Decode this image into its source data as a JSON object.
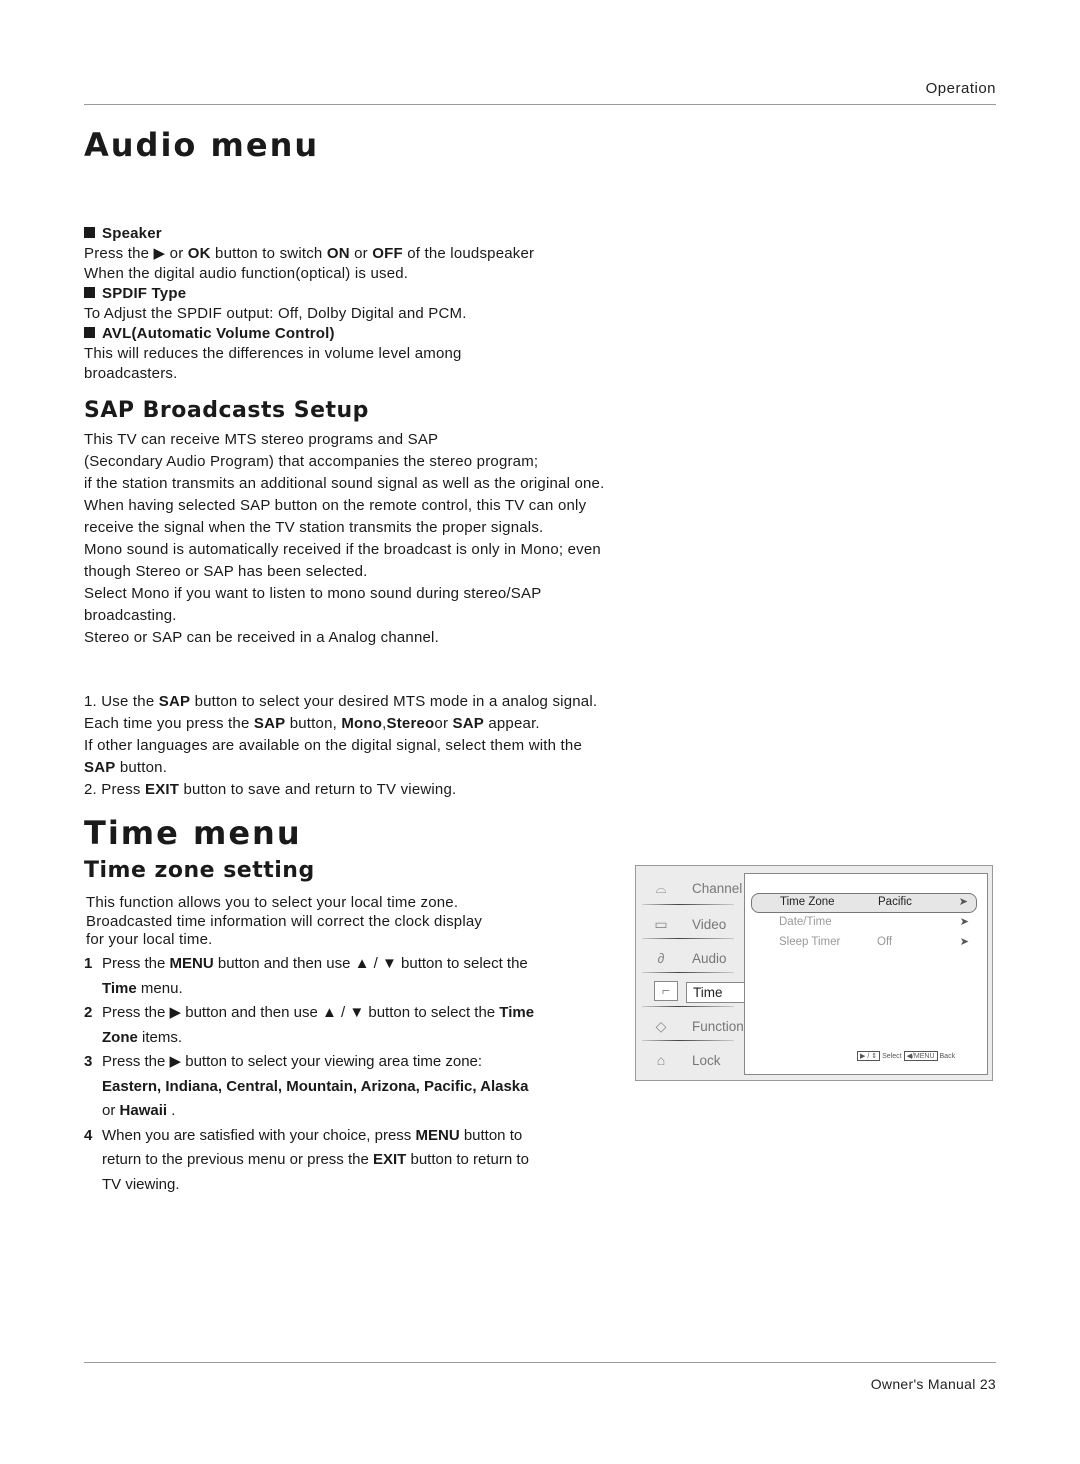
{
  "header": {
    "section_label": "Operation"
  },
  "audio_menu": {
    "title": "Audio menu",
    "items": [
      {
        "heading": "Speaker",
        "body": "Press the ▶ or OK button to switch ON or OFF of the loudspeaker When the digital audio function(optical) is used."
      },
      {
        "heading": "SPDIF Type",
        "body": "To Adjust the SPDIF output: Off, Dolby Digital and  PCM."
      },
      {
        "heading": "AVL(Automatic Volume Control)",
        "body": "This will reduces the differences in volume level among broadcasters."
      }
    ],
    "speaker_body": {
      "l1a": "Press the ",
      "l1b": " or ",
      "l1c": "OK",
      "l1d": " button to switch ",
      "l1e": "ON",
      "l1f": " or ",
      "l1g": "OFF",
      "l1h": " of the loudspeaker",
      "l2": "When the digital audio function(optical) is used."
    },
    "spdif_body": "To Adjust the SPDIF output: Off, Dolby Digital and  PCM.",
    "avl_body_1": "This will reduces the differences in volume level among",
    "avl_body_2": "broadcasters."
  },
  "sap": {
    "title": "SAP Broadcasts Setup",
    "lines": [
      "This TV can receive MTS stereo programs and SAP",
      "(Secondary Audio Program) that accompanies the stereo program;",
      "if the station transmits an additional sound signal as well as the original one.",
      "When having selected SAP button on the remote control, this TV can only",
      "receive the signal when the TV station transmits the proper signals.",
      "Mono sound is automatically received if the broadcast is only in Mono; even",
      "though Stereo or SAP has been selected.",
      "Select Mono if you want to listen to mono sound during stereo/SAP",
      "broadcasting.",
      "Stereo or SAP can be received in a Analog channel."
    ],
    "step1": {
      "a": "1. Use the ",
      "b": "SAP",
      "c": " button to select your desired MTS mode in a analog signal.",
      "d": "Each time you press the ",
      "e": "SAP",
      "f": " button, ",
      "g": "Mono",
      "h": ",",
      "i": "Stereo",
      "j": "or ",
      "k": "SAP",
      "l": " appear.",
      "m": "If other languages are available on the digital signal, select them with the",
      "n": "SAP",
      "o": " button."
    },
    "step2": {
      "a": "2. Press ",
      "b": "EXIT",
      "c": " button to save and return to TV viewing."
    }
  },
  "time_menu": {
    "title": "Time menu",
    "subtitle": "Time zone setting",
    "intro": [
      "This function allows you to select your local time zone.",
      "Broadcasted time information will correct the clock display",
      "for your local time."
    ],
    "steps": [
      {
        "num": "1",
        "parts": [
          "Press the ",
          "MENU",
          " button and then use ▲ / ▼ button to select the ",
          "Time",
          " menu."
        ]
      },
      {
        "num": "2",
        "parts": [
          "Press the ▶ button and then use ▲ / ▼ button to select the ",
          "Time Zone",
          " items."
        ]
      },
      {
        "num": "3",
        "parts": [
          "Press the ▶ button  to select your viewing area time zone:  ",
          "Eastern, Indiana, Central, Mountain,  Arizona, Pacific, Alaska",
          " or ",
          "Hawaii",
          " ."
        ]
      },
      {
        "num": "4",
        "parts": [
          "When you are satisfied with your choice,  press ",
          "MENU",
          " button to return to the previous menu or press the ",
          "EXIT",
          " button to return to TV viewing."
        ]
      }
    ]
  },
  "tv_osd": {
    "sidebar": [
      {
        "label": "Channel",
        "icon": "satellite-dish-icon",
        "glyph": "📡"
      },
      {
        "label": "Video",
        "icon": "monitor-icon",
        "glyph": "▭"
      },
      {
        "label": "Audio",
        "icon": "audio-icon",
        "glyph": "♫"
      },
      {
        "label": "Time",
        "icon": "clock-icon",
        "glyph": "⌐",
        "active": true
      },
      {
        "label": "Function",
        "icon": "function-icon",
        "glyph": "◇"
      },
      {
        "label": "Lock",
        "icon": "lock-icon",
        "glyph": "🔒"
      }
    ],
    "rows": [
      {
        "name": "Time Zone",
        "value": "Pacific",
        "arrow": "➤",
        "selected": true
      },
      {
        "name": "Date/Time",
        "value": "",
        "arrow": "➤"
      },
      {
        "name": "Sleep Timer",
        "value": "Off",
        "arrow": "➤"
      }
    ],
    "hint": {
      "key1": "▶ / ⇕",
      "select": "Select",
      "key2": "◀/MENU",
      "back": "Back"
    }
  },
  "footer": {
    "label": "Owner's Manual  23"
  }
}
